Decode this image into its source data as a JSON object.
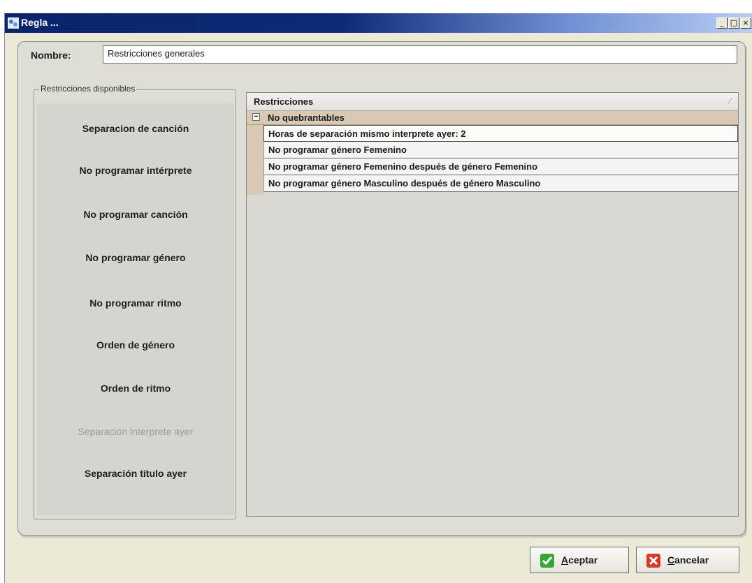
{
  "window": {
    "title": "Regla ...",
    "controls": [
      "_",
      "□",
      "×"
    ]
  },
  "form": {
    "nombre_label": "Nombre:",
    "nombre_value": "Restricciones generales"
  },
  "available": {
    "legend": "Restricciones disponibles",
    "items": [
      {
        "label": "Separacion de canción",
        "enabled": true
      },
      {
        "label": "No programar intérprete",
        "enabled": true
      },
      {
        "label": "No programar canción",
        "enabled": true
      },
      {
        "label": "No programar género",
        "enabled": true
      },
      {
        "label": "No programar ritmo",
        "enabled": true
      },
      {
        "label": "Orden de género",
        "enabled": true
      },
      {
        "label": "Orden de ritmo",
        "enabled": true
      },
      {
        "label": "Separación interprete ayer",
        "enabled": false
      },
      {
        "label": "Separación título ayer",
        "enabled": true
      }
    ]
  },
  "grid": {
    "header": "Restricciones",
    "group": {
      "expander": "−",
      "label": "No quebrantables"
    },
    "rows": [
      "Horas de separación mismo interprete ayer: 2",
      "No programar género Femenino",
      "No programar género Femenino después de género Femenino",
      "No programar género Masculino después de género Masculino"
    ]
  },
  "buttons": {
    "accept_mnemonic": "A",
    "accept_rest": "ceptar",
    "cancel_mnemonic": "C",
    "cancel_rest": "ancelar"
  },
  "colors": {
    "title_bar": "#0a246a",
    "group_row": "#d8c9b4",
    "accept_icon": "#3aa33a",
    "cancel_icon": "#d23a2e"
  }
}
